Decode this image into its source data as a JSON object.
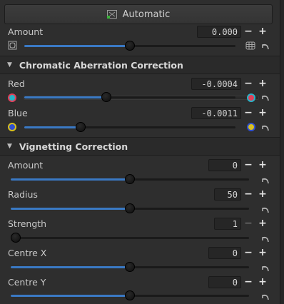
{
  "top_button": {
    "label": "Automatic",
    "icon": "lens-auto-icon"
  },
  "distortion": {
    "amount": {
      "label": "Amount",
      "value": "0.000",
      "slider_fraction": 0.5
    }
  },
  "ca": {
    "title": "Chromatic Aberration Correction",
    "red": {
      "label": "Red",
      "value": "-0.0004",
      "slider_fraction": 0.4
    },
    "blue": {
      "label": "Blue",
      "value": "-0.0011",
      "slider_fraction": 0.3
    }
  },
  "vignetting": {
    "title": "Vignetting Correction",
    "amount": {
      "label": "Amount",
      "value": "0",
      "slider_fraction": 0.5
    },
    "radius": {
      "label": "Radius",
      "value": "50",
      "slider_fraction": 0.5
    },
    "strength": {
      "label": "Strength",
      "value": "1",
      "slider_fraction": 0.0
    },
    "centre_x": {
      "label": "Centre X",
      "value": "0",
      "slider_fraction": 0.5
    },
    "centre_y": {
      "label": "Centre Y",
      "value": "0",
      "slider_fraction": 0.5
    }
  },
  "colors": {
    "accent": "#3a79c4",
    "red_dot": "#e0405a",
    "cyan_dot": "#28b4c8",
    "blue_dot": "#3050d0",
    "yellow_dot": "#d8c020"
  }
}
